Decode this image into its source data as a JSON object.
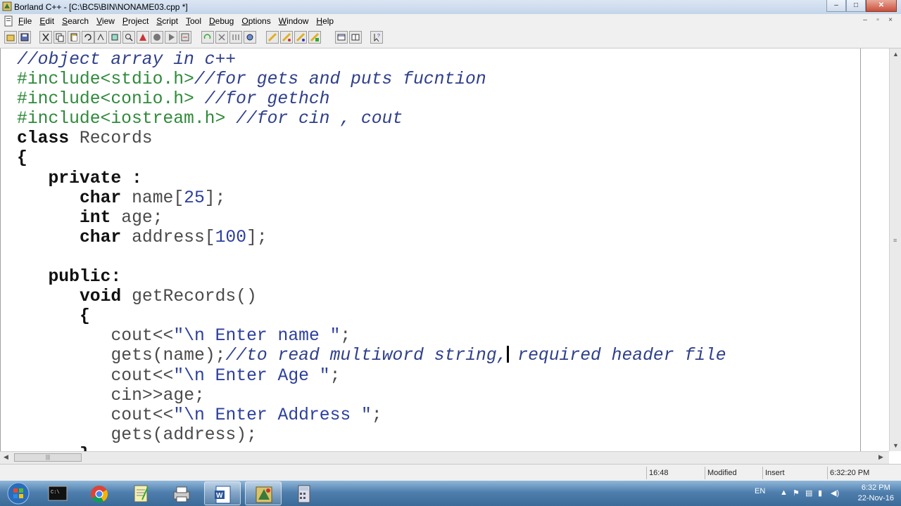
{
  "window": {
    "title": "Borland C++ - [C:\\BC5\\BIN\\NONAME03.cpp *]",
    "controls": [
      "–",
      "□",
      "✕"
    ]
  },
  "menu": {
    "items": [
      "File",
      "Edit",
      "Search",
      "View",
      "Project",
      "Script",
      "Tool",
      "Debug",
      "Options",
      "Window",
      "Help"
    ],
    "mdi_controls": [
      "–",
      "▫",
      "×"
    ]
  },
  "editor": {
    "file": "NONAME03.cpp",
    "lines": [
      "//object array in c++",
      "#include<stdio.h>//for gets and puts fucntion",
      "#include<conio.h> //for gethch",
      "#include<iostream.h> //for cin , cout",
      "class Records",
      "{",
      "   private :",
      "      char name[25];",
      "      int age;",
      "      char address[100];",
      "",
      "   public:",
      "      void getRecords()",
      "      {",
      "         cout<<\"\\n Enter name \";",
      "         gets(name);//to read multiword string, required header file",
      "         cout<<\"\\n Enter Age \";",
      "         cin>>age;",
      "         cout<<\"\\n Enter Address \";",
      "         gets(address);",
      "      }"
    ]
  },
  "statusbar": {
    "position": "16:48",
    "modified": "Modified",
    "mode": "Insert",
    "time": "6:32:20 PM"
  },
  "taskbar": {
    "language": "EN",
    "clock_time": "6:32 PM",
    "clock_date": "22-Nov-16"
  }
}
